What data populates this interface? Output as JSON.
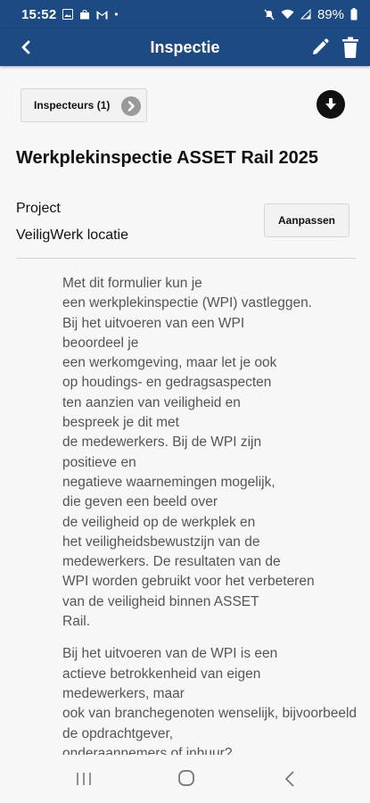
{
  "status_bar": {
    "time": "15:52",
    "battery": "89%",
    "left_icons": [
      "image-icon",
      "bag-icon",
      "gmail-icon",
      "dot-icon"
    ],
    "right_icons": [
      "mute-icon",
      "wifi-icon",
      "signal-icon",
      "battery-icon"
    ]
  },
  "app_bar": {
    "title": "Inspectie",
    "actions": [
      "back-icon",
      "pencil-icon",
      "trash-icon"
    ],
    "color": "#1d4a82"
  },
  "inspectors_button": {
    "label": "Inspecteurs (1)"
  },
  "form": {
    "title": "Werkplekinspectie ASSET Rail 2025",
    "project_label": "Project",
    "project_value": "VeiligWerk locatie",
    "project_edit_label": "Aanpassen"
  },
  "description": {
    "paragraph1": [
      "Met dit formulier kun je",
      "een werkplekinspectie (WPI) vastleggen.",
      "Bij het uitvoeren van een WPI",
      "beoordeel je",
      "een werkomgeving, maar let je ook",
      "op houdings- en gedragsaspecten",
      "ten aanzien van veiligheid en",
      "bespreek je dit met",
      "de medewerkers. Bij de WPI zijn",
      "positieve en",
      "negatieve waarnemingen mogelijk,",
      "die geven een beeld over",
      "de veiligheid op de werkplek en",
      "het veiligheidsbewustzijn van de",
      "medewerkers. De resultaten van de",
      "WPI worden gebruikt voor het verbeteren",
      "van de veiligheid binnen ASSET",
      "Rail."
    ],
    "paragraph2": [
      "Bij het uitvoeren van de WPI is een",
      "actieve betrokkenheid van eigen",
      "medewerkers, maar",
      "ook van branchegenoten wenselijk, bijvoorbeeld",
      "de opdrachtgever,",
      "onderaannemers of inhuur?"
    ]
  },
  "nav_bar": {
    "buttons": [
      "recents-icon",
      "home-icon",
      "back-nav-icon"
    ]
  }
}
